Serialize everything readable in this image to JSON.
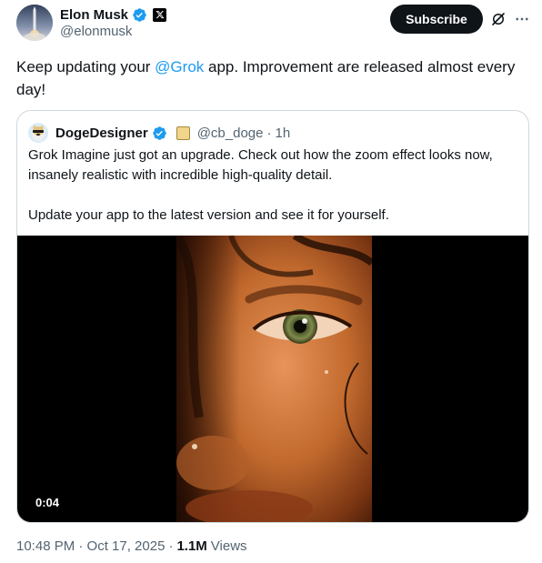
{
  "author": {
    "name": "Elon Musk",
    "handle": "@elonmusk",
    "avatar_icon": "rocket-launch-avatar",
    "verified_icon": "verified-badge-icon",
    "affiliation_icon": "x-logo-icon"
  },
  "actions": {
    "subscribe_label": "Subscribe",
    "grok_icon": "grok-icon",
    "more_icon": "more-icon"
  },
  "tweet": {
    "text_before": "Keep updating your ",
    "mention": "@Grok",
    "text_after": " app. Improvement are released almost every day!"
  },
  "quote": {
    "name": "DogeDesigner",
    "handle": "@cb_doge",
    "separator": "·",
    "time": "1h",
    "paragraph1": "Grok Imagine just got an upgrade. Check out how the zoom effect looks now, insanely realistic with incredible high-quality detail.",
    "paragraph2": "Update your app to the latest version and see it for yourself.",
    "video_duration": "0:04"
  },
  "meta": {
    "timestamp": "10:48 PM · Oct 17, 2025",
    "separator": "·",
    "views_count": "1.1M",
    "views_label": "Views"
  },
  "colors": {
    "accent": "#1d9bf0",
    "text": "#0f1419",
    "secondary": "#536471",
    "border": "#cfd9de"
  }
}
